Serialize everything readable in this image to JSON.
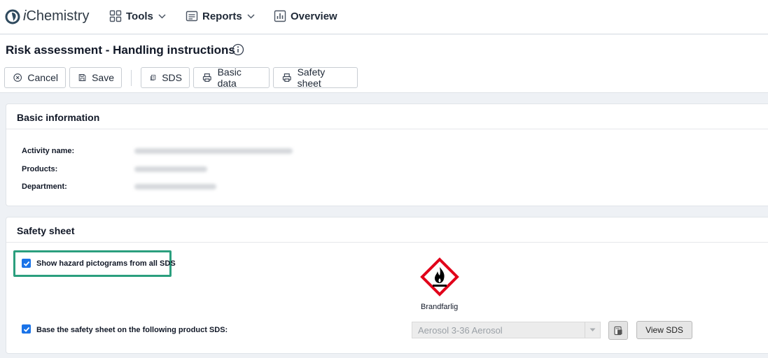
{
  "app": {
    "logo_text": "Chemistry",
    "logo_prefix": "i"
  },
  "nav": {
    "tools": "Tools",
    "reports": "Reports",
    "overview": "Overview"
  },
  "page": {
    "title": "Risk assessment - Handling instructions"
  },
  "toolbar": {
    "cancel": "Cancel",
    "save": "Save",
    "sds": "SDS",
    "basic_data": "Basic data",
    "safety_sheet": "Safety sheet"
  },
  "basic_info": {
    "heading": "Basic information",
    "activity_label": "Activity name:",
    "products_label": "Products:",
    "department_label": "Department:"
  },
  "safety_sheet": {
    "heading": "Safety sheet",
    "show_pictograms_label": "Show hazard pictograms from all SDS",
    "show_pictograms_checked": true,
    "pictogram_label": "Brandfarlig",
    "pictogram_icon": "flammable-icon",
    "base_on_sds_label": "Base the safety sheet on the following product SDS:",
    "base_on_sds_checked": true,
    "product_select_value": "Aerosol 3-36 Aerosol",
    "view_sds_button": "View SDS"
  },
  "colors": {
    "highlight": "#2b9f7e",
    "checkbox": "#1a73e8",
    "pictogram_border": "#e1001a"
  }
}
